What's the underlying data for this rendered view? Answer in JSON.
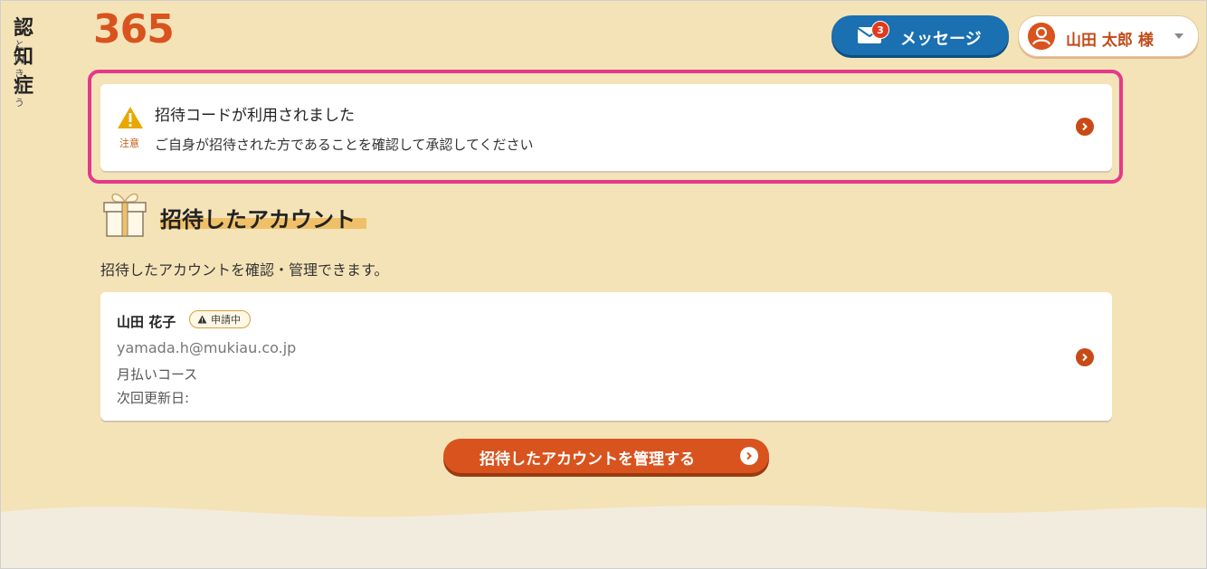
{
  "brand": {
    "kanji": "認知症",
    "sub": "と向き合う",
    "number": "365"
  },
  "header": {
    "messages_label": "メッセージ",
    "messages_badge": "3",
    "user_name": "山田 太郎 様"
  },
  "notice": {
    "warning_label": "注意",
    "title": "招待コードが利用されました",
    "text": "ご自身が招待された方であることを確認して承認してください"
  },
  "section": {
    "title": "招待したアカウント",
    "description": "招待したアカウントを確認・管理できます。"
  },
  "account": {
    "name": "山田 花子",
    "status_badge": "申請中",
    "email": "yamada.h@mukiau.co.jp",
    "course": "月払いコース",
    "renewal_label": "次回更新日:"
  },
  "manage_button": {
    "label": "招待したアカウントを管理する"
  },
  "colors": {
    "background": "#f5e3b8",
    "accent": "#d9531e",
    "message_blue": "#1a70b0",
    "highlight_outline": "#e4398a",
    "warning": "#e8a800"
  }
}
